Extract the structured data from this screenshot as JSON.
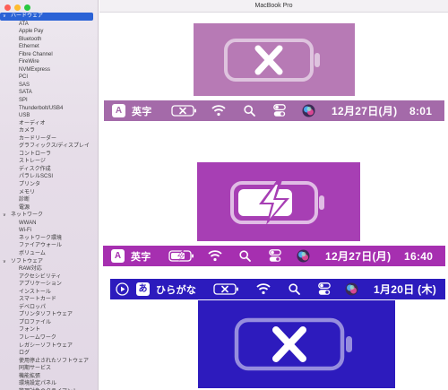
{
  "window": {
    "title": "MacBook Pro"
  },
  "sidebar": {
    "sections": [
      {
        "label": "ハードウェア",
        "selected": true,
        "items": [
          "ATA",
          "Apple Pay",
          "Bluetooth",
          "Ethernet",
          "Fibre Channel",
          "FireWire",
          "NVMExpress",
          "PCI",
          "SAS",
          "SATA",
          "SPI",
          "Thunderbolt/USB4",
          "USB",
          "オーディオ",
          "カメラ",
          "カードリーダー",
          "グラフィックス/ディスプレイ",
          "コントローラ",
          "ストレージ",
          "ディスク作成",
          "パラレルSCSI",
          "プリンタ",
          "メモリ",
          "診断",
          "電源"
        ]
      },
      {
        "label": "ネットワーク",
        "selected": false,
        "items": [
          "WWAN",
          "Wi-Fi",
          "ネットワーク環境",
          "ファイアウォール",
          "ボリューム"
        ]
      },
      {
        "label": "ソフトウェア",
        "selected": false,
        "items": [
          "RAW対応",
          "アクセシビリティ",
          "アプリケーション",
          "インストール",
          "スマートカード",
          "デベロッパ",
          "プリンタソフトウェア",
          "プロファイル",
          "フォント",
          "フレームワーク",
          "レガシーソフトウェア",
          "ログ",
          "使用停止されたソフトウェア",
          "同期サービス",
          "機能拡張",
          "環境設定パネル",
          "管理対象のクライアント"
        ]
      }
    ]
  },
  "menubar1": {
    "ime": "A",
    "input_source": "英字",
    "date": "12月27日(月)",
    "time": "8:01",
    "battery_state": "error"
  },
  "menubar2": {
    "ime": "A",
    "input_source": "英字",
    "date": "12月27日(月)",
    "time": "16:40",
    "battery_state": "charging"
  },
  "menubar3": {
    "ime": "あ",
    "input_source": "ひらがな",
    "date": "1月20日 (木)",
    "battery_state": "error"
  },
  "icons": {
    "battery_error": "battery-x-icon",
    "battery_charging": "battery-bolt-icon",
    "wifi": "wifi-icon",
    "search": "search-icon",
    "control_center": "control-center-icon",
    "siri": "siri-icon",
    "play": "play-circle-icon"
  },
  "colors": {
    "panel1": "#b77ab5",
    "panel2": "#a73fb4",
    "panel3": "#2d1bbd",
    "menubar1": "#a46aa9",
    "menubar2": "#a62fb0",
    "menubar3": "#2c1bbd",
    "selection": "#2a62d6"
  }
}
